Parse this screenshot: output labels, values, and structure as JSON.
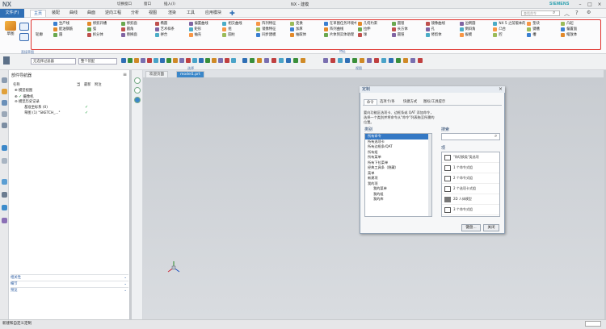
{
  "titlebar": {
    "logo": "NX",
    "quick_access": [
      "切换窗口",
      "窗口",
      "插入(I)"
    ],
    "title": "NX - 建模",
    "brand": "SIEMENS"
  },
  "menu": {
    "file": "文件(F)",
    "tabs": [
      "主页",
      "装配",
      "曲线",
      "曲面",
      "逆向工程",
      "分析",
      "视图",
      "渲染",
      "工具",
      "应用模块"
    ],
    "active_tab": "主页",
    "search_placeholder": "查找命令"
  },
  "ribbon": {
    "sketch_label": "草图",
    "direct_sketch": "直接草图",
    "group_label": "轮廓",
    "columns": [
      [
        "生产线",
        "配油钢筋",
        "圆"
      ],
      [
        "修剪开槽",
        "弧",
        "拆分体"
      ],
      [
        "修剪面",
        "圆角",
        "替换面"
      ],
      [
        "椭圆",
        "艺术样条",
        "拼合"
      ],
      [
        "偏置曲线",
        "矩形",
        "抽壳"
      ],
      [
        "相交曲线",
        "组",
        "圆柱"
      ],
      [
        "阵列特征",
        "镜像特征",
        "同步建模"
      ],
      [
        "变换",
        "加厚",
        "抽取体"
      ],
      [
        "在草图任务环境中打开",
        "阵列曲线",
        "片体到实体助理"
      ],
      [
        "几何约束",
        "拉伸",
        "球"
      ],
      [
        "圆锥",
        "长方体",
        "圆锥"
      ],
      [
        "镜像曲线",
        "孔",
        "修剪体"
      ],
      [
        "边倒圆",
        "倒斜角",
        "拔模"
      ],
      [
        "NX 5 之前版本的孔",
        "凸台",
        "腔"
      ],
      [
        "垫块",
        "键槽",
        "槽"
      ],
      [
        "凸起",
        "偏置面",
        "缩放体"
      ]
    ],
    "group_footer": "直接草图",
    "section_label": "特征"
  },
  "toolbar2": {
    "filter": "无选择过滤器",
    "assembly": "整个装配",
    "group_label": "选择",
    "view_label": "视图"
  },
  "navigator": {
    "title": "部件导航器",
    "columns": [
      "名称",
      "当",
      "最新",
      "附注"
    ],
    "tree": [
      "模型视图",
      "摄像机",
      "模型历史记录",
      "基准坐标系 (0)",
      "草图 (1) \"SKETCH_...\""
    ],
    "footers": [
      "相关性",
      "细节",
      "预览"
    ]
  },
  "view_tabs": [
    "欢迎页面",
    "model1.prt"
  ],
  "dialog": {
    "title": "定制",
    "tabs": [
      "命令",
      "选项卡/条",
      "快捷方式",
      "图标/工具提示"
    ],
    "active_tab": "命令",
    "description": "要向功能区选项卡、边框条或 QAT 添加命令，选择一个类别并将命令从\"命令\"列表拖至所需的位置。",
    "category_label": "类别",
    "search_label": "搜索",
    "commands_label": "项",
    "categories": [
      "所有命令",
      "所有选项卡",
      "所有边框条/QAT",
      "所有组",
      "所有菜单",
      "所有下拉菜单",
      "经典工具条（隐藏）",
      "菜单",
      "新建项",
      "我的项",
      "我的菜单",
      "我的组",
      "我的库"
    ],
    "selected_category": "所有命令",
    "commands": [
      "\"和切换类\"类选项",
      "1 个命令式组",
      "2 个命令式组",
      "2 个选项卡式组",
      "2D 人体模型",
      "3 个命令式组"
    ],
    "buttons": {
      "keyboard": "键盘...",
      "close": "关闭"
    }
  },
  "status": {
    "left": "新建和自定义定制"
  },
  "colors": {
    "accent": "#2f6fb5",
    "highlight": "#e0322e",
    "check": "#1d9b3a"
  }
}
